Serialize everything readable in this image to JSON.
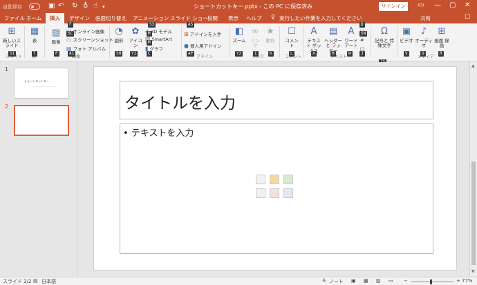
{
  "titlebar": {
    "autosave": "自動保存",
    "title": "ショートカットキー.pptx - この PC に保存済み",
    "signin": "サインイン",
    "qa_icons": [
      "save-icon",
      "undo-icon",
      "redo-icon",
      "presentation-icon",
      "touch-icon",
      "customize-icon"
    ]
  },
  "tabs": {
    "items": [
      "ファイル",
      "ホーム",
      "挿入",
      "デザイン",
      "画面切り替え",
      "アニメーション",
      "スライド ショー",
      "校閲",
      "表示",
      "ヘルプ"
    ],
    "active": "挿入",
    "search": "実行したい作業を入力してください",
    "share": "共有"
  },
  "ribbon": {
    "new_slide": "新しいスライド",
    "table": "表",
    "image": "画像",
    "online_image": "オンライン画像",
    "screenshot": "スクリーンショット",
    "photo_album": "フォト アルバム",
    "shapes": "図形",
    "icons": "アイコン",
    "model3d": "3D モデル",
    "smartart": "SmartArt",
    "graph": "グラフ",
    "addin_get": "アドインを入手",
    "personal_addin": "個人用アドイン",
    "zoom": "ズーム",
    "link": "リンク",
    "action": "動作",
    "comment": "コメント",
    "textbox": "テキスト ボックス",
    "header_footer": "ヘッダーと フッター",
    "wordart": "ワード アート",
    "symbol": "記号と 特殊文字",
    "video": "ビデオ",
    "audio": "オーディオ",
    "screen_record": "画面 録画",
    "groups": [
      "スライド",
      "表",
      "画像",
      "アドイン",
      "リンク",
      "コメント",
      "テキスト",
      "メディア"
    ]
  },
  "keytips": [
    "F",
    "H",
    "N",
    "G",
    "K",
    "A",
    "S",
    "R",
    "W",
    "Y",
    "ZS",
    "SI",
    "T",
    "P",
    "Y1",
    "A1",
    "SH",
    "C",
    "M",
    "S3",
    "AS",
    "AP",
    "Y2",
    "I",
    "K",
    "L",
    "X",
    "H",
    "W",
    "J",
    "U",
    "D",
    "SN",
    "V",
    "O",
    "R",
    "F",
    "SC"
  ],
  "slides": [
    {
      "number": "1",
      "title": "ショートカットキー",
      "subtitle": "——————————"
    },
    {
      "number": "2"
    }
  ],
  "slide": {
    "title_placeholder": "タイトルを入力",
    "body_placeholder": "テキストを入力"
  },
  "status": {
    "slide_count": "スライド 2/2",
    "language": "日本語",
    "notes": "ノート",
    "zoom": "77%"
  },
  "colors": {
    "accent": "#c6512f",
    "selected_thumb": "#e35f37"
  }
}
